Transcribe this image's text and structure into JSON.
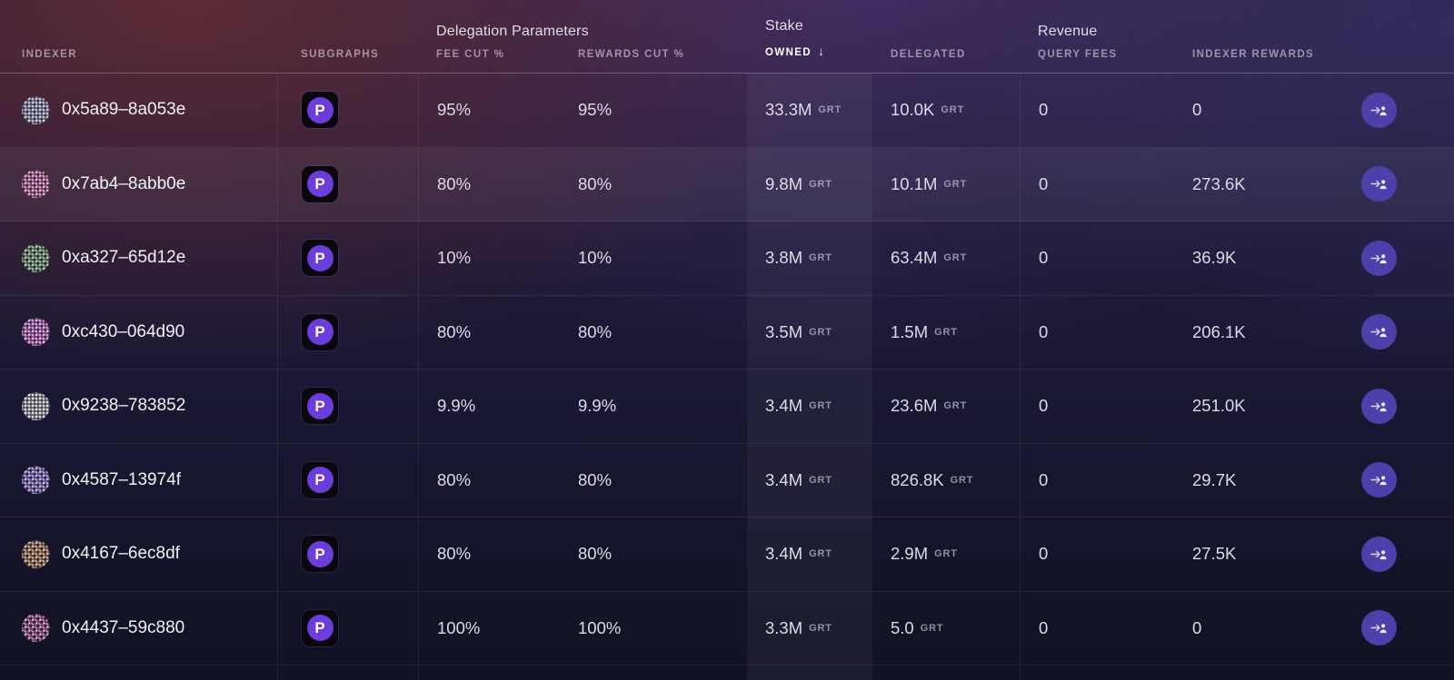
{
  "table": {
    "groups": {
      "delegation_parameters": "Delegation Parameters",
      "stake": "Stake",
      "revenue": "Revenue"
    },
    "columns": {
      "indexer": "INDEXER",
      "subgraphs": "SUBGRAPHS",
      "fee_cut": "FEE CUT %",
      "rewards_cut": "REWARDS CUT %",
      "owned": "OWNED",
      "delegated": "DELEGATED",
      "query_fees": "QUERY FEES",
      "indexer_rewards": "INDEXER REWARDS"
    },
    "sort": {
      "column": "OWNED",
      "direction": "descending",
      "arrow": "↓"
    },
    "unit": "GRT",
    "rows": [
      {
        "address": "0x5a89–8a053e",
        "fee_cut": "95%",
        "rewards_cut": "95%",
        "owned": "33.3M",
        "delegated": "10.0K",
        "query_fees": "0",
        "indexer_rewards": "0",
        "avatar_css": "--c1:#98a3c9;--c2:#f1f3f8"
      },
      {
        "address": "0x7ab4–8abb0e",
        "fee_cut": "80%",
        "rewards_cut": "80%",
        "owned": "9.8M",
        "delegated": "10.1M",
        "query_fees": "0",
        "indexer_rewards": "273.6K",
        "avatar_css": "--c1:#e0559c;--c2:#f5eef4"
      },
      {
        "address": "0xa327–65d12e",
        "fee_cut": "10%",
        "rewards_cut": "10%",
        "owned": "3.8M",
        "delegated": "63.4M",
        "query_fees": "0",
        "indexer_rewards": "36.9K",
        "avatar_css": "--c1:#49943f;--c2:#f0f4ee"
      },
      {
        "address": "0xc430–064d90",
        "fee_cut": "80%",
        "rewards_cut": "80%",
        "owned": "3.5M",
        "delegated": "1.5M",
        "query_fees": "0",
        "indexer_rewards": "206.1K",
        "avatar_css": "--c1:#e351de;--c2:#f6eef6"
      },
      {
        "address": "0x9238–783852",
        "fee_cut": "9.9%",
        "rewards_cut": "9.9%",
        "owned": "3.4M",
        "delegated": "23.6M",
        "query_fees": "0",
        "indexer_rewards": "251.0K",
        "avatar_css": "--c1:#bccabf;--c2:#f7f8f6"
      },
      {
        "address": "0x4587–13974f",
        "fee_cut": "80%",
        "rewards_cut": "80%",
        "owned": "3.4M",
        "delegated": "826.8K",
        "query_fees": "0",
        "indexer_rewards": "29.7K",
        "avatar_css": "--c1:#7a5cd8;--c2:#f2f0fa"
      },
      {
        "address": "0x4167–6ec8df",
        "fee_cut": "80%",
        "rewards_cut": "80%",
        "owned": "3.4M",
        "delegated": "2.9M",
        "query_fees": "0",
        "indexer_rewards": "27.5K",
        "avatar_css": "--c1:#a9631f;--c2:#f4f1ea"
      },
      {
        "address": "0x4437–59c880",
        "fee_cut": "100%",
        "rewards_cut": "100%",
        "owned": "3.3M",
        "delegated": "5.0",
        "query_fees": "0",
        "indexer_rewards": "0",
        "avatar_css": "--c1:#9e2478;--c2:#f1edf3"
      }
    ]
  },
  "icons": {
    "subgraph_letter": "P"
  },
  "colors": {
    "delegate_button": "#4e40ab",
    "subgraph_circle": "#6b3ddb",
    "band_highlight": "rgba(255,255,255,0.045)",
    "bg_top_left": "#3c2532",
    "bg_bottom_right": "#111222"
  }
}
